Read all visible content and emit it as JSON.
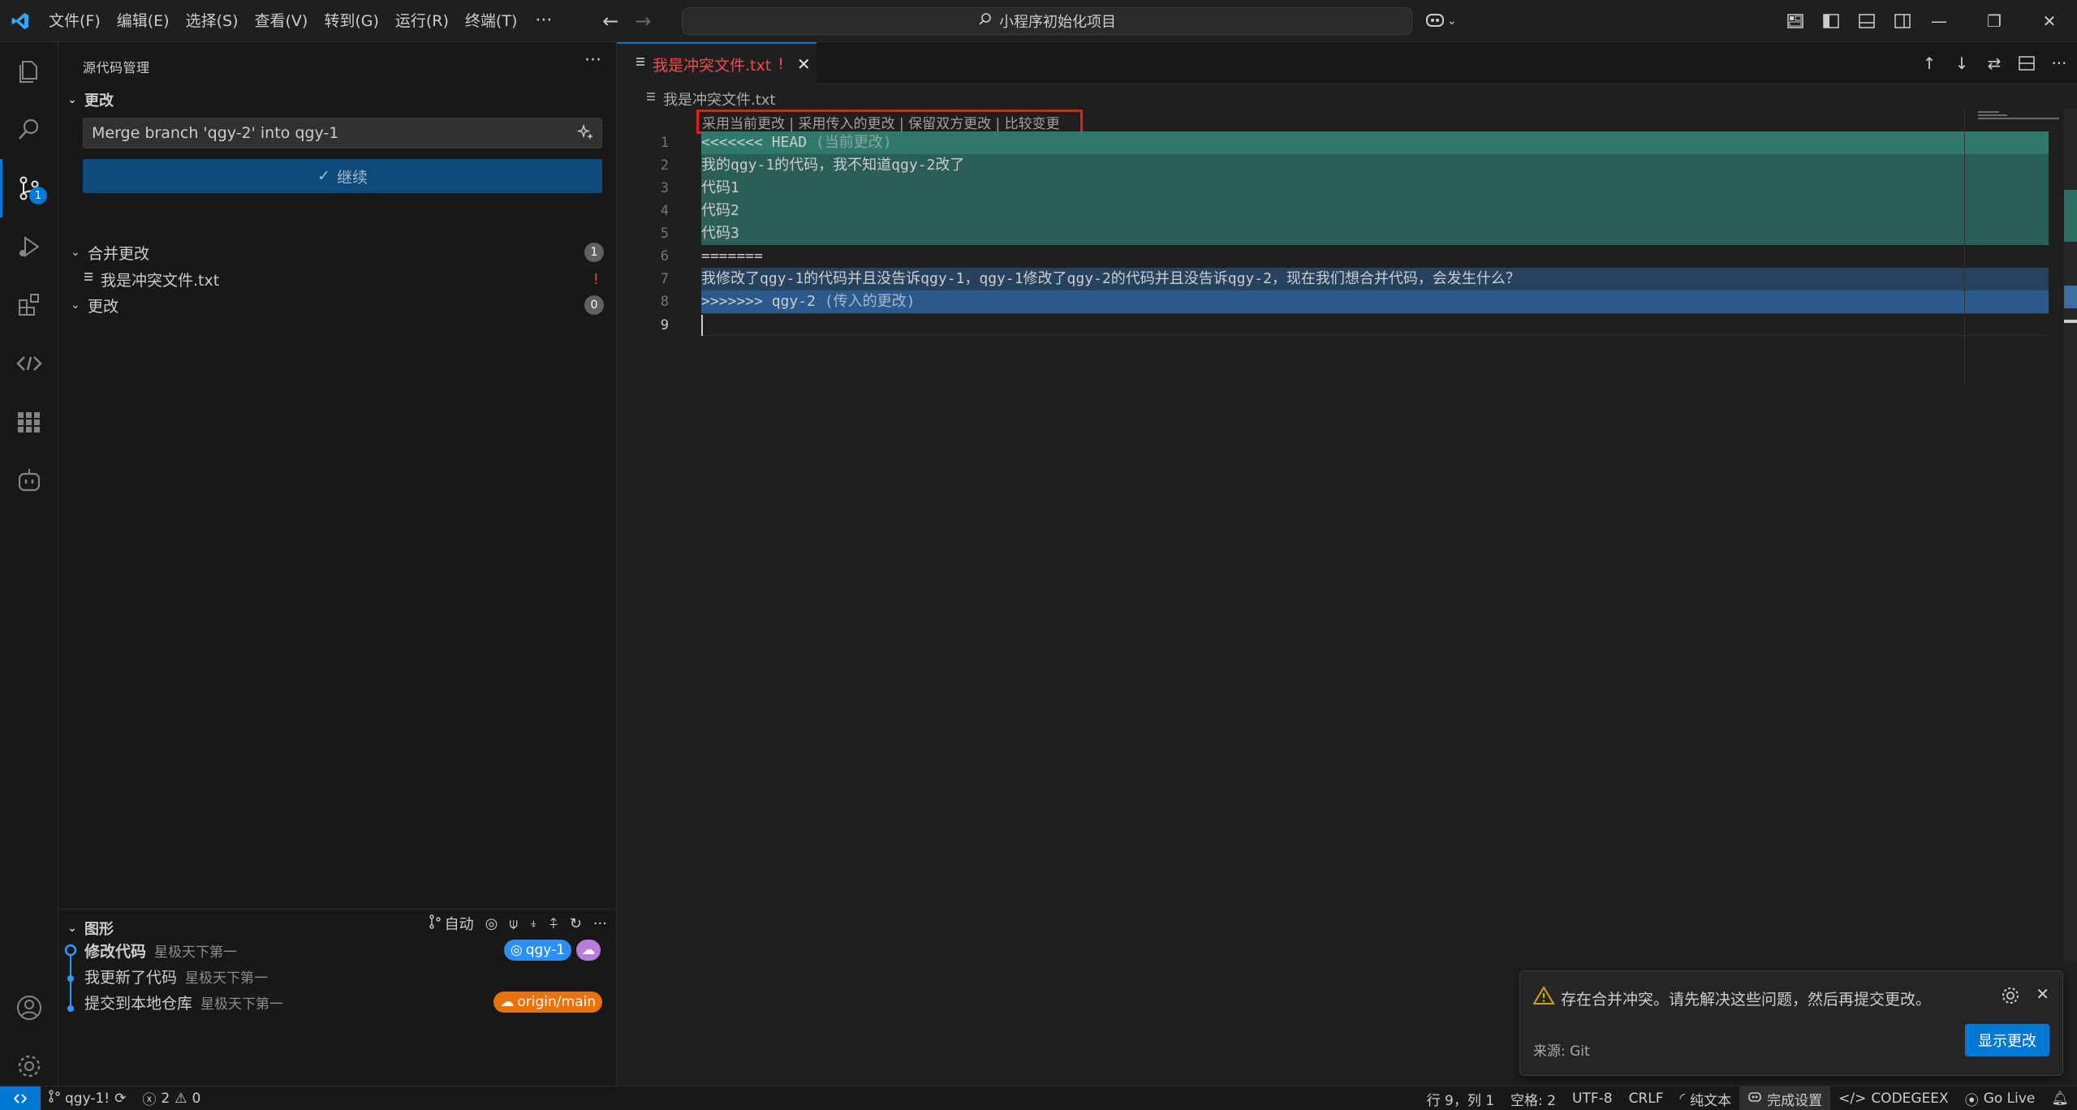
{
  "titlebar": {
    "menus": [
      "文件(F)",
      "编辑(E)",
      "选择(S)",
      "查看(V)",
      "转到(G)",
      "运行(R)",
      "终端(T)"
    ],
    "search_text": "小程序初始化项目"
  },
  "activity": {
    "scm_badge": "1"
  },
  "sidebar": {
    "header": "源代码管理",
    "changes_section": "更改",
    "commit_message": "Merge branch 'qgy-2' into qgy-1",
    "commit_button": "继续",
    "merge_changes_label": "合并更改",
    "merge_changes_count": "1",
    "conflict_file": "我是冲突文件.txt",
    "conflict_status": "!",
    "changes_label": "更改",
    "changes_count": "0"
  },
  "graph": {
    "title": "图形",
    "auto_label": "自动",
    "commits": [
      {
        "message": "修改代码",
        "author": "星极天下第一"
      },
      {
        "message": "我更新了代码",
        "author": "星极天下第一"
      },
      {
        "message": "提交到本地仓库",
        "author": "星极天下第一"
      }
    ],
    "ref_local": "qgy-1",
    "ref_remote": "origin/main"
  },
  "editor": {
    "tab_label": "我是冲突文件.txt",
    "tab_status": "!",
    "breadcrumb": "我是冲突文件.txt",
    "codelens": "采用当前更改 | 采用传入的更改 | 保留双方更改 | 比较变更",
    "lines": [
      {
        "num": "1",
        "text": "<<<<<<< HEAD",
        "annot": " (当前更改)"
      },
      {
        "num": "2",
        "text": "我的qgy-1的代码，我不知道qgy-2改了",
        "annot": ""
      },
      {
        "num": "3",
        "text": "代码1",
        "annot": ""
      },
      {
        "num": "4",
        "text": "代码2",
        "annot": ""
      },
      {
        "num": "5",
        "text": "代码3",
        "annot": ""
      },
      {
        "num": "6",
        "text": "=======",
        "annot": ""
      },
      {
        "num": "7",
        "text": "我修改了qgy-1的代码并且没告诉qgy-1，qgy-1修改了qgy-2的代码并且没告诉qgy-2，现在我们想合并代码，会发生什么？",
        "annot": ""
      },
      {
        "num": "8",
        "text": ">>>>>>> qgy-2",
        "annot": " (传入的更改)"
      },
      {
        "num": "9",
        "text": "",
        "annot": ""
      }
    ]
  },
  "notification": {
    "message": "存在合并冲突。请先解决这些问题，然后再提交更改。",
    "source": "来源: Git",
    "action": "显示更改"
  },
  "statusbar": {
    "branch": "qgy-1!",
    "errors": "2",
    "warnings": "0",
    "position": "行 9，列 1",
    "spaces": "空格: 2",
    "encoding": "UTF-8",
    "eol": "CRLF",
    "language": "纯文本",
    "copilot": "完成设置",
    "codegeex": "CODEGEEX",
    "golive": "Go Live"
  },
  "colors": {
    "accent": "#0078d4",
    "conflict_current": "#2a5e57",
    "conflict_incoming": "#27425e",
    "error_red": "#f14c4c",
    "highlight_box": "#e0201a"
  }
}
